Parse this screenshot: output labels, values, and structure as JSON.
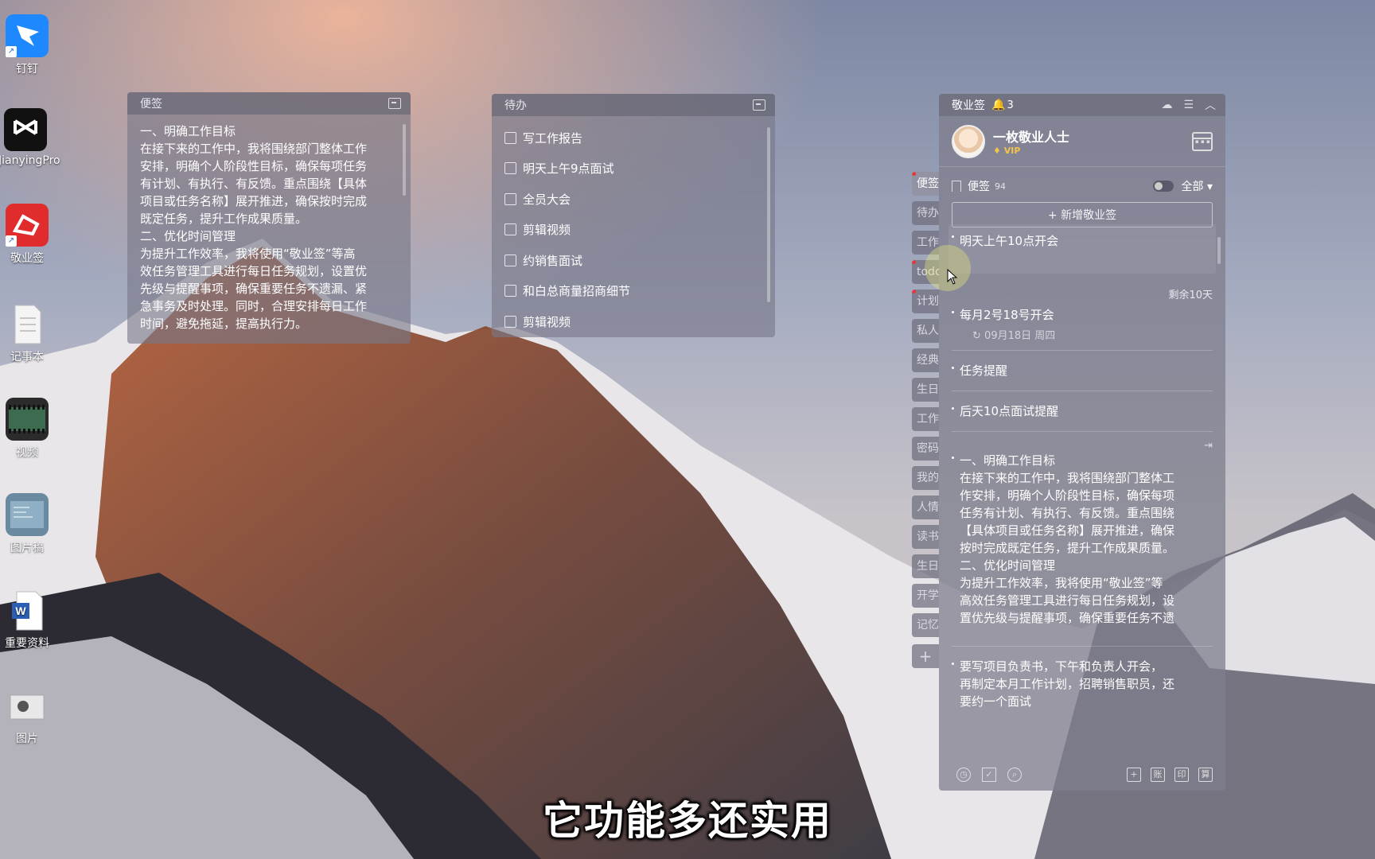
{
  "desktop": {
    "icons": [
      {
        "label": "钉钉",
        "icon": "dingtalk-icon",
        "color": "#1e88ff"
      },
      {
        "label": "JianyingPro",
        "icon": "capcut-icon",
        "color": "#111111"
      },
      {
        "label": "敬业签",
        "icon": "jingyeqian-icon",
        "color": "#e02c2c"
      },
      {
        "label": "记事本",
        "icon": "notepad-icon",
        "color": "#f4f4f4"
      },
      {
        "label": "视频",
        "icon": "video-folder-icon",
        "color": "#2b2b2b"
      },
      {
        "label": "图片稿",
        "icon": "image-folder-icon",
        "color": "#6a8aa0"
      },
      {
        "label": "重要资料",
        "icon": "word-doc-icon",
        "color": "#2b5fb3"
      },
      {
        "label": "图片",
        "icon": "pictures-folder-icon",
        "color": "#e8e8e8"
      }
    ]
  },
  "note_panel": {
    "title": "便签",
    "text_lines": [
      "一、明确工作目标",
      "在接下来的工作中，我将围绕部门整体工作",
      "安排，明确个人阶段性目标，确保每项任务",
      "有计划、有执行、有反馈。重点围绕【具体",
      "项目或任务名称】展开推进，确保按时完成",
      "既定任务，提升工作成果质量。",
      "二、优化时间管理",
      "为提升工作效率，我将使用“敬业签”等高",
      "效任务管理工具进行每日任务规划，设置优",
      "先级与提醒事项，确保重要任务不遗漏、紧",
      "急事务及时处理。同时，合理安排每日工作",
      "时间，避免拖延，提高执行力。"
    ]
  },
  "todo_panel": {
    "title": "待办",
    "items": [
      "写工作报告",
      "明天上午9点面试",
      "全员大会",
      "剪辑视频",
      "约销售面试",
      "和白总商量招商细节",
      "剪辑视频"
    ]
  },
  "side_tabs": [
    {
      "label": "便签",
      "active": true,
      "dot": true
    },
    {
      "label": "待办",
      "active": false,
      "dot": false
    },
    {
      "label": "工作",
      "active": false,
      "dot": false
    },
    {
      "label": "todo",
      "active": false,
      "dot": true
    },
    {
      "label": "计划",
      "active": false,
      "dot": true
    },
    {
      "label": "私人",
      "active": false,
      "dot": false
    },
    {
      "label": "经典",
      "active": false,
      "dot": false
    },
    {
      "label": "生日",
      "active": false,
      "dot": false
    },
    {
      "label": "工作",
      "active": false,
      "dot": false
    },
    {
      "label": "密码",
      "active": false,
      "dot": false
    },
    {
      "label": "我的",
      "active": false,
      "dot": false
    },
    {
      "label": "人情",
      "active": false,
      "dot": false
    },
    {
      "label": "读书",
      "active": false,
      "dot": false
    },
    {
      "label": "生日",
      "active": false,
      "dot": false
    },
    {
      "label": "开学",
      "active": false,
      "dot": false
    },
    {
      "label": "记忆",
      "active": false,
      "dot": false
    }
  ],
  "side_add": "+",
  "main": {
    "app_title": "敬业签",
    "notif_count": "3",
    "user": {
      "name": "一枚敬业人士",
      "badge": "VIP"
    },
    "filter": {
      "label": "便签",
      "count": "94",
      "scope": "全部"
    },
    "add_label": "+ 新增敬业签",
    "notes": {
      "n1": "明天上午10点开会",
      "remain": "剩余10天",
      "n2": "每月2号18号开会",
      "n2_repeat": "09月18日 周四",
      "n3": "任务提醒",
      "n4": "后天10点面试提醒",
      "n5_lines": [
        "一、明确工作目标",
        "在接下来的工作中，我将围绕部门整体工",
        "作安排，明确个人阶段性目标，确保每项",
        "任务有计划、有执行、有反馈。重点围绕",
        "【具体项目或任务名称】展开推进，确保",
        "按时完成既定任务，提升工作成果质量。",
        "二、优化时间管理",
        "为提升工作效率，我将使用“敬业签”等",
        "高效任务管理工具进行每日任务规划，设",
        "置优先级与提醒事项，确保重要任务不遗"
      ],
      "n6_lines": [
        "要写项目负责书，下午和负责人开会，",
        "再制定本月工作计划，招聘销售职员，还",
        "要约一个面试"
      ]
    },
    "footer": {
      "right_buttons": [
        "+",
        "账",
        "印",
        "算"
      ]
    }
  },
  "subtitle": "它功能多还实用"
}
